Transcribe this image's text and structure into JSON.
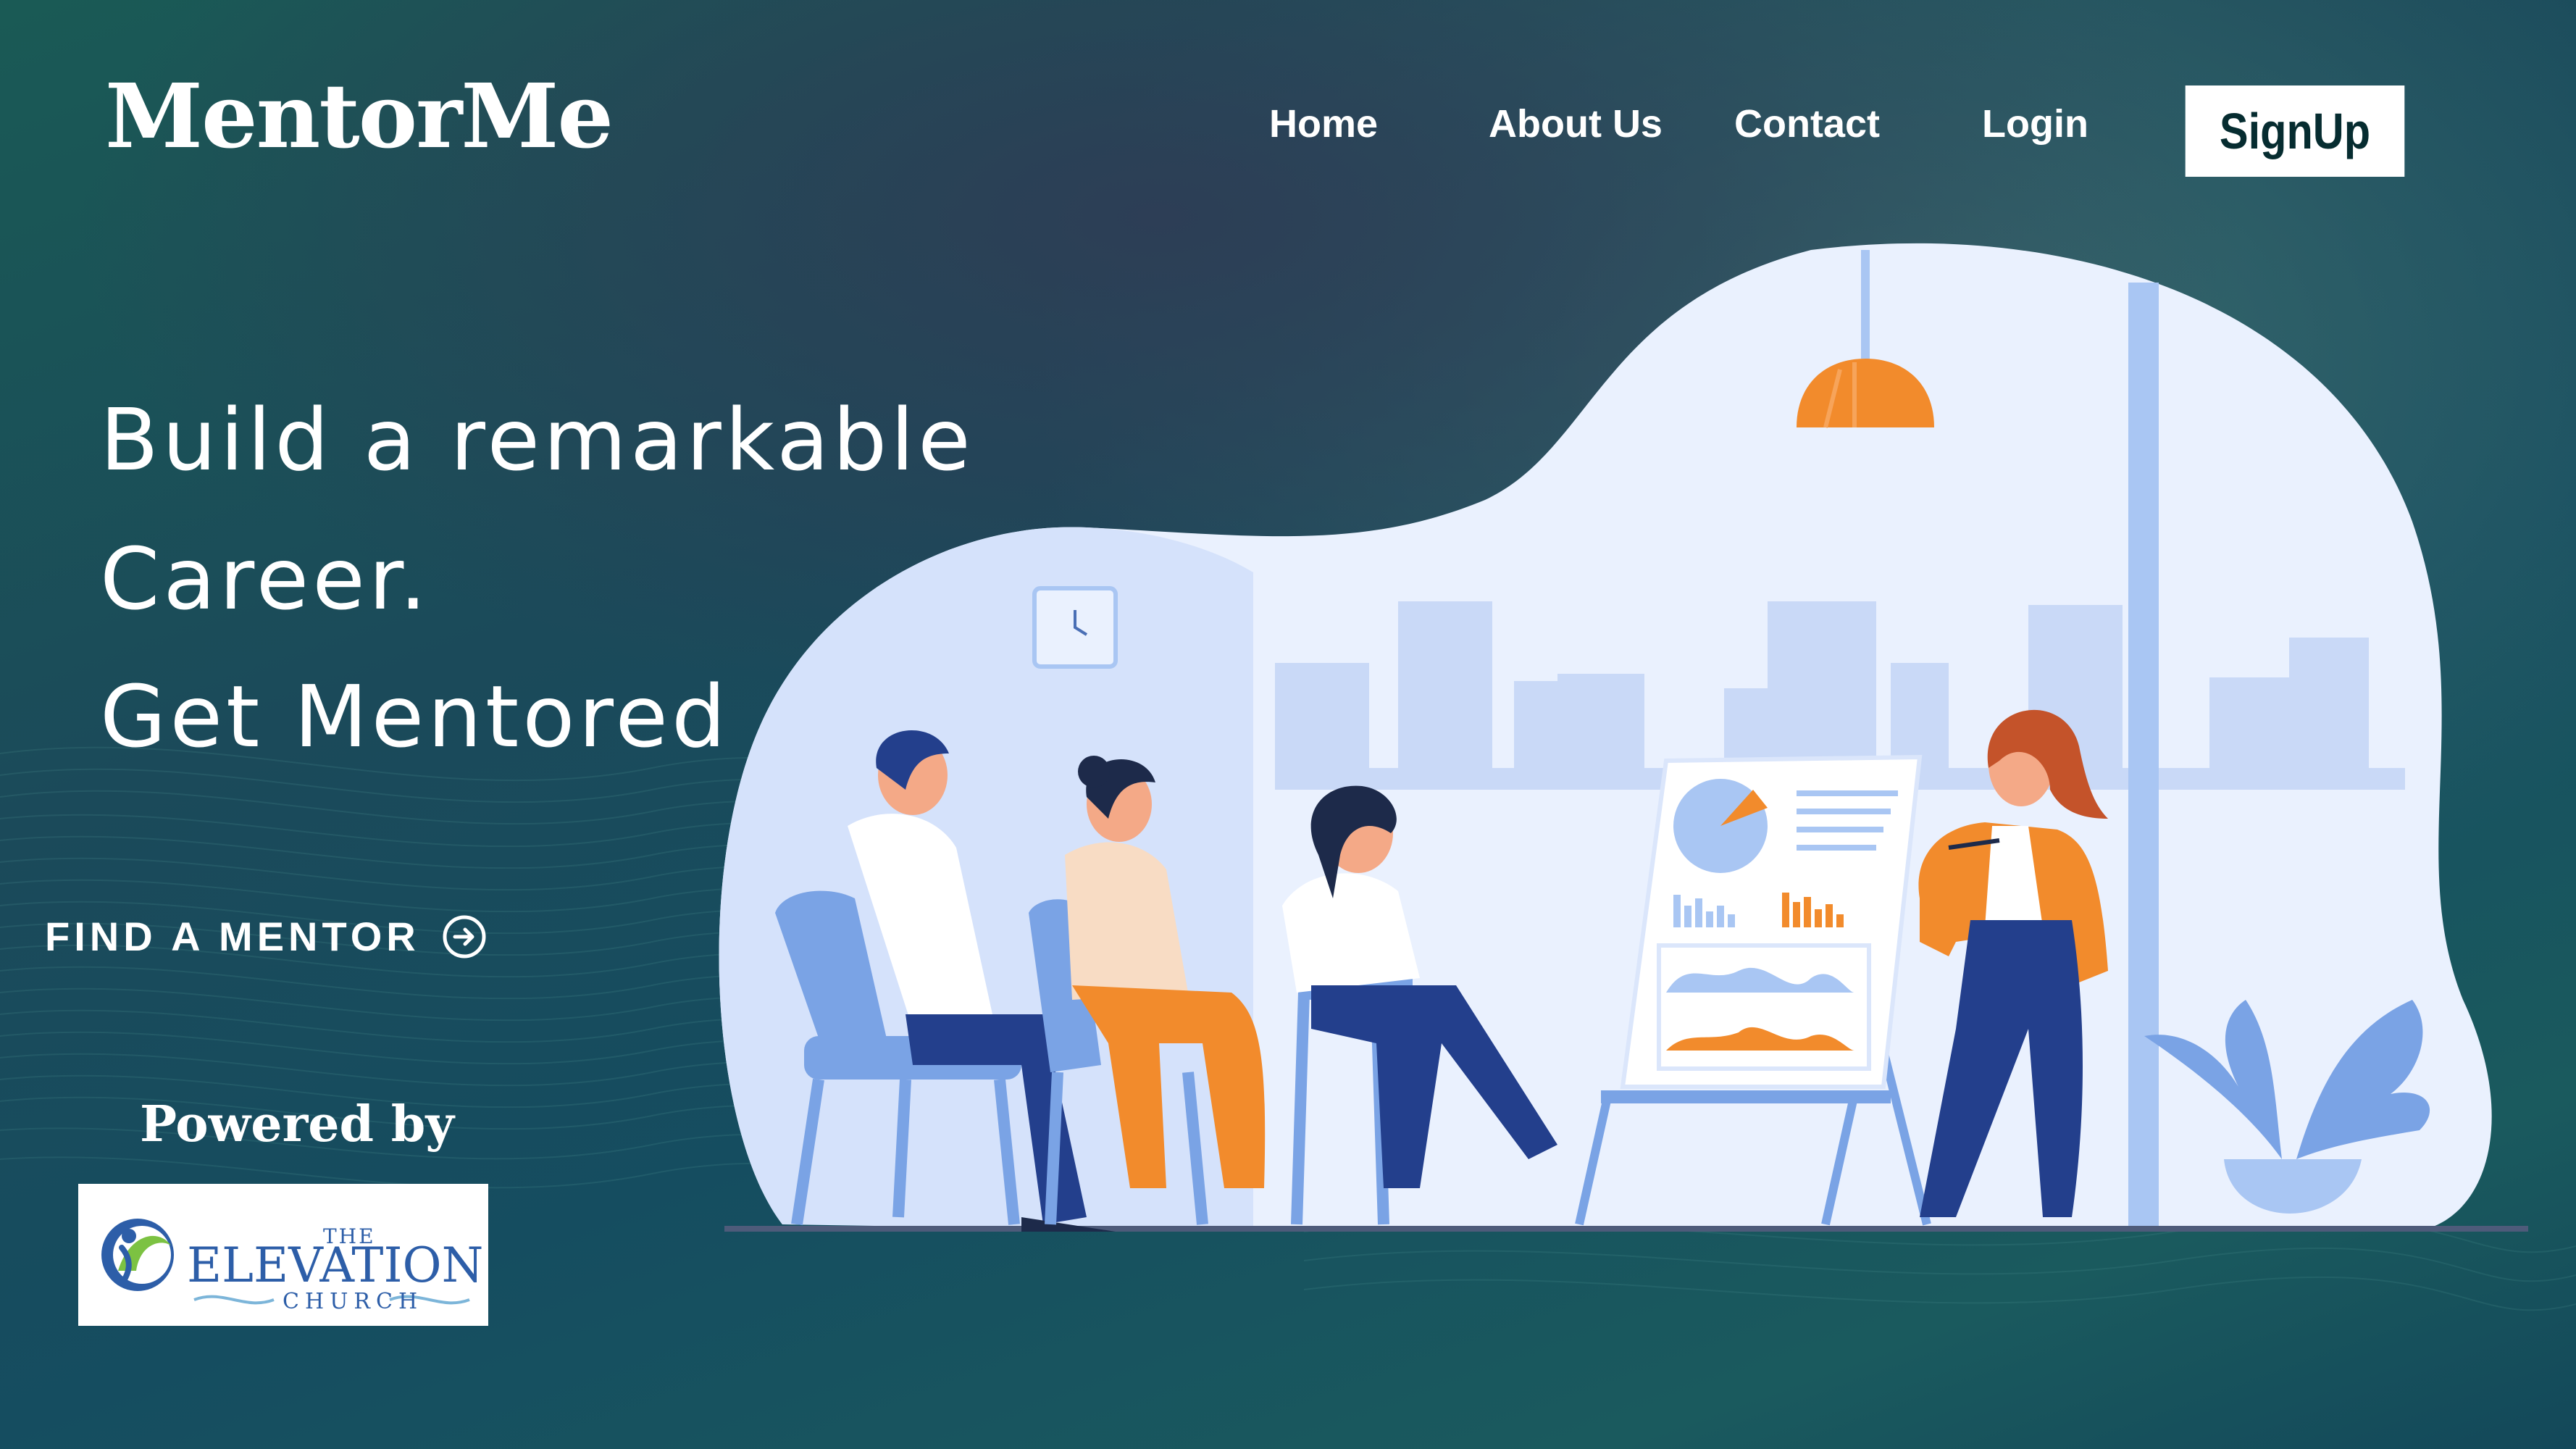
{
  "app": {
    "logo": "MentorMe"
  },
  "nav": {
    "items": [
      {
        "label": "Home"
      },
      {
        "label": "About Us"
      },
      {
        "label": "Contact"
      },
      {
        "label": "Login"
      }
    ],
    "signup_label": "SignUp"
  },
  "hero": {
    "line1": "Build a remarkable",
    "line2": "Career.",
    "line3": "Get Mentored"
  },
  "cta": {
    "label": "FIND A MENTOR",
    "icon": "arrow-right-circle-icon"
  },
  "sponsor": {
    "powered_by": "Powered by",
    "org_logo_text": "THE ELEVATION CHURCH"
  },
  "colors": {
    "background": "#1a5060",
    "illustration_bg": "#eaf1fe",
    "accent_orange": "#f28b2c",
    "navy": "#233f8c"
  }
}
